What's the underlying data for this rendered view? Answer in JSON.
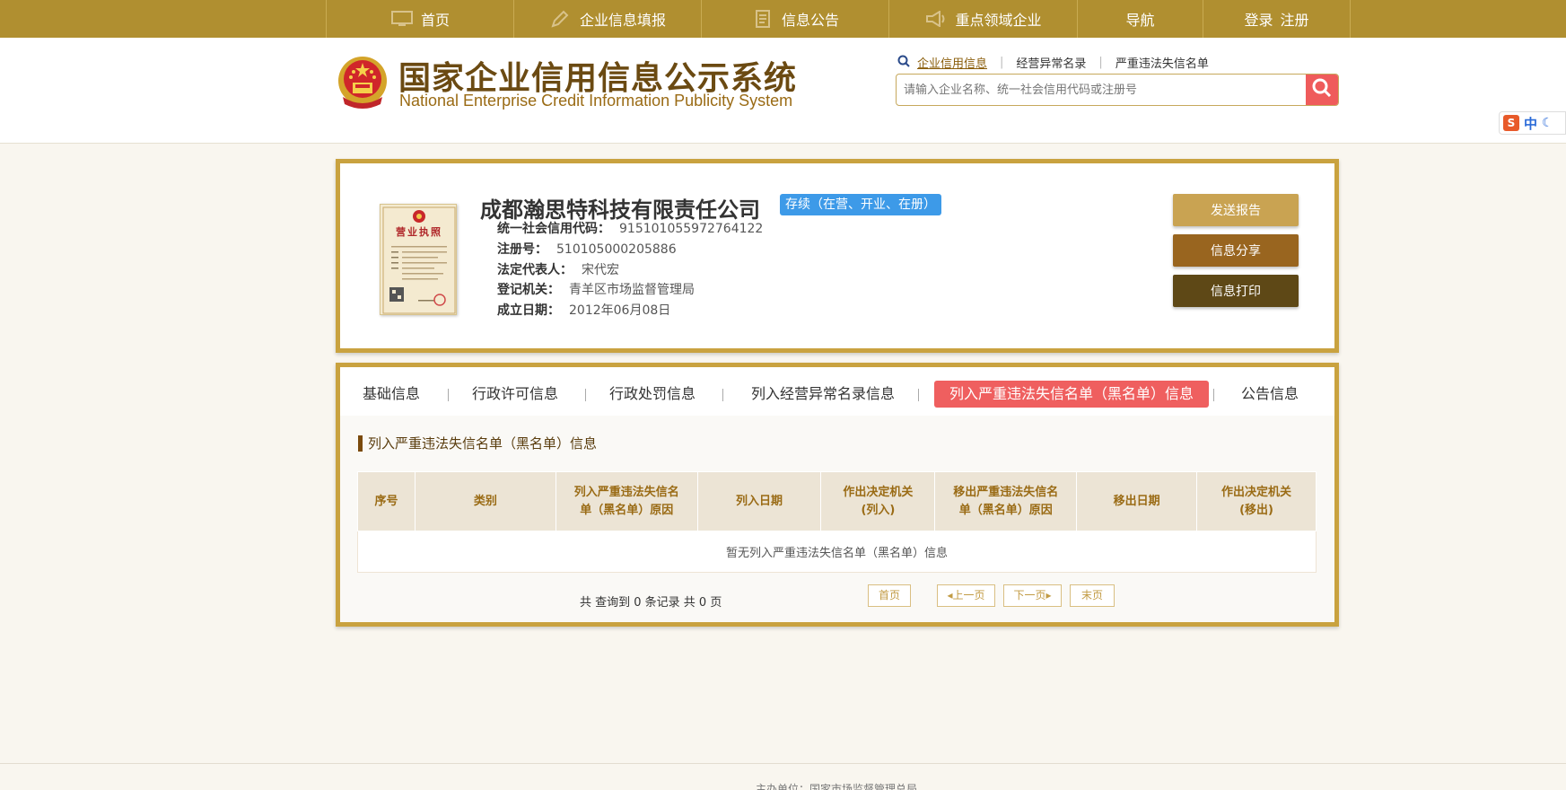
{
  "nav": {
    "items": [
      {
        "label": "首页",
        "icon": "monitor-icon"
      },
      {
        "label": "企业信息填报",
        "icon": "pen-icon"
      },
      {
        "label": "信息公告",
        "icon": "document-icon"
      },
      {
        "label": "重点领域企业",
        "icon": "megaphone-icon"
      },
      {
        "label": "导航"
      }
    ],
    "login": "登录",
    "register": "注册"
  },
  "header": {
    "title_cn": "国家企业信用信息公示系统",
    "title_en": "National Enterprise Credit Information Publicity System",
    "search_links": [
      "企业信用信息",
      "经营异常名录",
      "严重违法失信名单"
    ],
    "search_placeholder": "请输入企业名称、统一社会信用代码或注册号",
    "lang_label": "中"
  },
  "company": {
    "name": "成都瀚思特科技有限责任公司",
    "status": "存续（在营、开业、在册）",
    "license_title": "营业执照",
    "fields": [
      {
        "label": "统一社会信用代码：",
        "value": "915101055972764122"
      },
      {
        "label": "注册号：",
        "value": "510105000205886"
      },
      {
        "label": "法定代表人：",
        "value": "宋代宏"
      },
      {
        "label": "登记机关：",
        "value": "青羊区市场监督管理局"
      },
      {
        "label": "成立日期：",
        "value": "2012年06月08日"
      }
    ],
    "buttons": [
      "发送报告",
      "信息分享",
      "信息打印"
    ]
  },
  "tabs": {
    "items": [
      "基础信息",
      "行政许可信息",
      "行政处罚信息",
      "列入经营异常名录信息",
      "列入严重违法失信名单（黑名单）信息",
      "公告信息"
    ],
    "active_index": 4
  },
  "section": {
    "title": "列入严重违法失信名单（黑名单）信息",
    "columns": [
      [
        "序号"
      ],
      [
        "类别"
      ],
      [
        "列入严重违法失信名",
        "单（黑名单）原因"
      ],
      [
        "列入日期"
      ],
      [
        "作出决定机关",
        "(列入)"
      ],
      [
        "移出严重违法失信名",
        "单（黑名单）原因"
      ],
      [
        "移出日期"
      ],
      [
        "作出决定机关",
        "(移出)"
      ]
    ],
    "empty_text": "暂无列入严重违法失信名单（黑名单）信息",
    "pager_info": "共 查询到 0 条记录 共 0 页",
    "pager": {
      "first": "首页",
      "prev": "上一页",
      "next": "下一页",
      "last": "末页"
    }
  },
  "footer": {
    "text": "主办单位：国家市场监督管理总局"
  },
  "colors": {
    "nav_bg": "#b08f30",
    "card_border": "#c9a23f",
    "active_tab": "#ef5f5f",
    "status_badge": "#3d9ae8"
  }
}
